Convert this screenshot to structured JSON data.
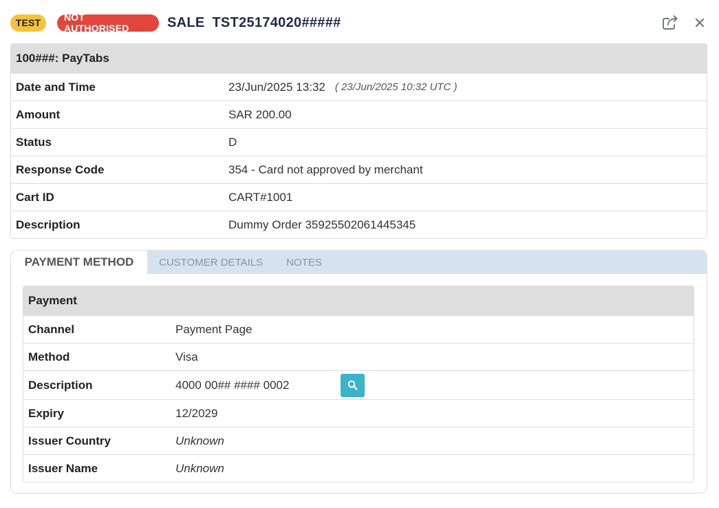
{
  "header": {
    "badge_test": "TEST",
    "badge_status": "NOT AUTHORISED",
    "title": "SALE  TST25174020#####",
    "share_icon": "share-icon",
    "close_icon": "close-icon"
  },
  "summary": {
    "heading": "100###: PayTabs",
    "rows": [
      {
        "label": "Date and Time",
        "value": "23/Jun/2025 13:32",
        "extra": "( 23/Jun/2025 10:32 UTC )"
      },
      {
        "label": "Amount",
        "value": "SAR 200.00"
      },
      {
        "label": "Status",
        "value": "D"
      },
      {
        "label": "Response Code",
        "value": "354 - Card not approved by merchant"
      },
      {
        "label": "Cart ID",
        "value": "CART#1001"
      },
      {
        "label": "Description",
        "value": "Dummy Order 35925502061445345"
      }
    ]
  },
  "tabs": [
    {
      "label": "PAYMENT METHOD",
      "active": true
    },
    {
      "label": "CUSTOMER DETAILS",
      "active": false
    },
    {
      "label": "NOTES",
      "active": false
    }
  ],
  "payment": {
    "heading": "Payment",
    "rows": [
      {
        "label": "Channel",
        "value": "Payment Page"
      },
      {
        "label": "Method",
        "value": "Visa"
      },
      {
        "label": "Description",
        "value": "4000 00## #### 0002",
        "action_icon": "search-icon"
      },
      {
        "label": "Expiry",
        "value": "12/2029"
      },
      {
        "label": "Issuer Country",
        "value": "Unknown"
      },
      {
        "label": "Issuer Name",
        "value": "Unknown"
      }
    ]
  },
  "colors": {
    "badge_test": "#f4c33b",
    "badge_status": "#e0463c",
    "tab_bar": "#d5e3f1",
    "table_head": "#dedede",
    "search_button": "#3bb3c8"
  }
}
